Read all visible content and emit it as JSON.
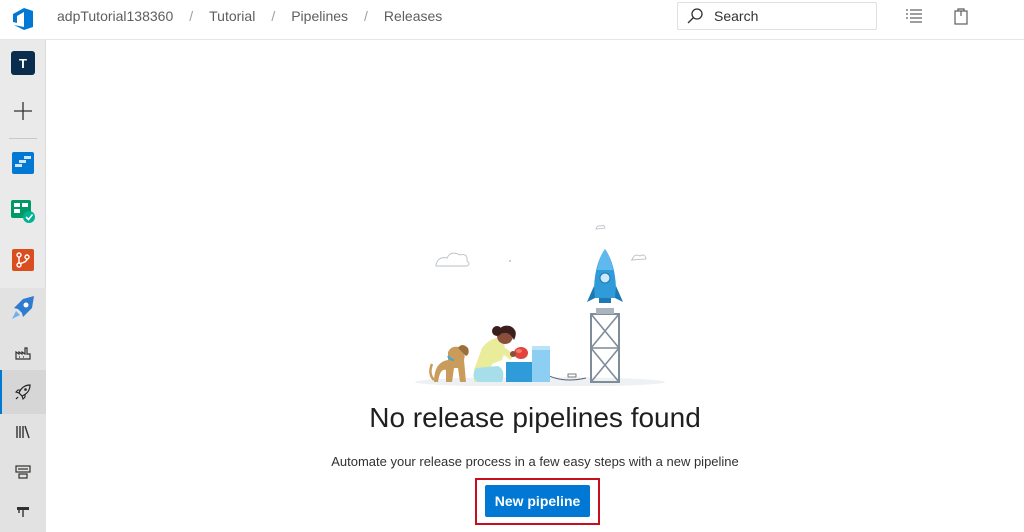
{
  "header": {
    "breadcrumbs": [
      "adpTutorial138360",
      "Tutorial",
      "Pipelines",
      "Releases"
    ],
    "search_placeholder": "Search"
  },
  "nav": {
    "project_initial": "T",
    "items": [
      {
        "name": "new-item",
        "icon": "plus-icon"
      },
      {
        "name": "overview",
        "icon": "overview-icon"
      },
      {
        "name": "boards",
        "icon": "boards-icon"
      },
      {
        "name": "repos",
        "icon": "repos-icon"
      },
      {
        "name": "pipelines",
        "icon": "pipelines-icon"
      },
      {
        "name": "builds",
        "icon": "builds-icon"
      },
      {
        "name": "releases",
        "icon": "rocket-icon",
        "selected": true
      },
      {
        "name": "library",
        "icon": "library-icon"
      },
      {
        "name": "task-groups",
        "icon": "task-groups-icon"
      },
      {
        "name": "deployment-groups",
        "icon": "deployment-groups-icon"
      }
    ]
  },
  "empty_state": {
    "title": "No release pipelines found",
    "subtitle": "Automate your release process in a few easy steps with a new pipeline",
    "button_label": "New pipeline"
  },
  "colors": {
    "accent": "#0078d4",
    "highlight_border": "#c50f1f",
    "nav_background": "#eaeaea"
  }
}
